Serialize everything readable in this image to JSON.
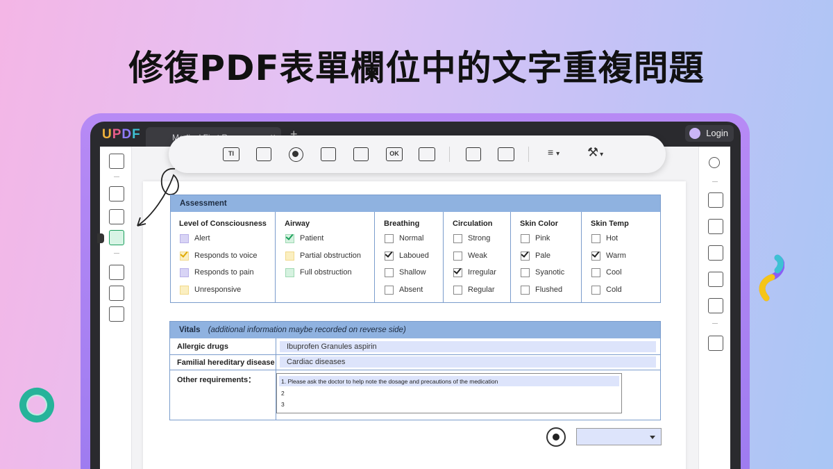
{
  "headline": "修復PDF表單欄位中的文字重複問題",
  "app": {
    "logo": {
      "u": "U",
      "p": "P",
      "d": "D",
      "f": "F"
    },
    "tab_title": "Medical First Response",
    "tab_close": "×",
    "tab_add": "+",
    "login_label": "Login"
  },
  "toolbar": {
    "text_field_glyph": "TI",
    "ok_button_glyph": "OK",
    "align_caret": "▾",
    "tools_caret": "▾"
  },
  "assessment": {
    "title": "Assessment",
    "columns": [
      {
        "title": "Level of Consciousness",
        "options": [
          {
            "label": "Alert",
            "style": "purple",
            "checked": false
          },
          {
            "label": "Responds to voice",
            "style": "yellow",
            "checked": true
          },
          {
            "label": "Responds to pain",
            "style": "purple",
            "checked": false
          },
          {
            "label": "Unresponsive",
            "style": "yellow",
            "checked": false
          }
        ]
      },
      {
        "title": "Airway",
        "options": [
          {
            "label": "Patient",
            "style": "green",
            "checked": true
          },
          {
            "label": "Partial obstruction",
            "style": "yellow",
            "checked": false
          },
          {
            "label": "Full obstruction",
            "style": "green",
            "checked": false
          }
        ]
      },
      {
        "title": "Breathing",
        "options": [
          {
            "label": "Normal",
            "style": "plain",
            "checked": false
          },
          {
            "label": "Laboued",
            "style": "plain",
            "checked": true
          },
          {
            "label": "Shallow",
            "style": "plain",
            "checked": false
          },
          {
            "label": "Absent",
            "style": "plain",
            "checked": false
          }
        ]
      },
      {
        "title": "Circulation",
        "options": [
          {
            "label": "Strong",
            "style": "plain",
            "checked": false
          },
          {
            "label": "Weak",
            "style": "plain",
            "checked": false
          },
          {
            "label": "Irregular",
            "style": "plain",
            "checked": true
          },
          {
            "label": "Regular",
            "style": "plain",
            "checked": false
          }
        ]
      },
      {
        "title": "Skin Color",
        "options": [
          {
            "label": "Pink",
            "style": "plain",
            "checked": false
          },
          {
            "label": "Pale",
            "style": "plain",
            "checked": true
          },
          {
            "label": "Syanotic",
            "style": "plain",
            "checked": false
          },
          {
            "label": "Flushed",
            "style": "plain",
            "checked": false
          }
        ]
      },
      {
        "title": "Skin Temp",
        "options": [
          {
            "label": "Hot",
            "style": "plain",
            "checked": false
          },
          {
            "label": "Warm",
            "style": "plain",
            "checked": true
          },
          {
            "label": "Cool",
            "style": "plain",
            "checked": false
          },
          {
            "label": "Cold",
            "style": "plain",
            "checked": false
          }
        ]
      }
    ]
  },
  "vitals": {
    "title": "Vitals",
    "subtitle": "(additional information maybe recorded on reverse side)",
    "allergic_label": "Allergic drugs",
    "allergic_value": "Ibuprofen Granules  aspirin",
    "familial_label": "Familial hereditary disease",
    "familial_value": "Cardiac diseases",
    "other_label": "Other requirements：",
    "other_lines": [
      "1. Please ask the doctor to help note the dosage and precautions of the medication",
      "2",
      "3"
    ]
  },
  "dropdown_value": ""
}
